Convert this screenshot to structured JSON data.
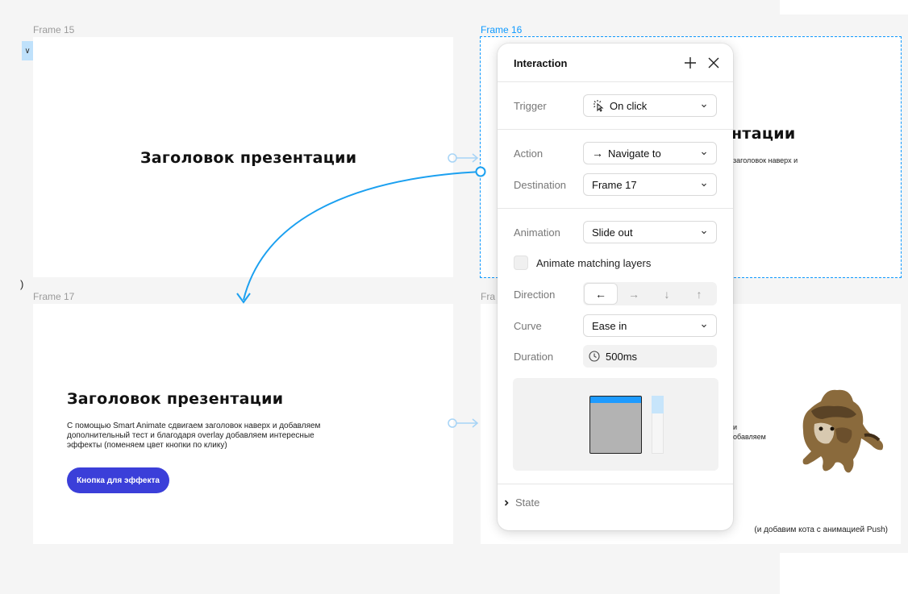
{
  "canvas": {
    "frames": [
      {
        "label": "Frame 15",
        "title": "Заголовок презентации"
      },
      {
        "label": "Frame 16",
        "title_partial": "нтации",
        "text_partial": "заголовок наверх и"
      },
      {
        "label": "Frame 17",
        "title": "Заголовок презентации",
        "text": "С помощью Smart Animate сдвигаем заголовок наверх и добавляем дополнительный тест и благодаря overlay добавляем интересные эффекты (поменяем цвет кнопки по клику)",
        "button_label": "Кнопка для эффекта"
      },
      {
        "label": "Fra",
        "text_partial_1": "и",
        "text_partial_2": "обавляем",
        "caption": "(и добавим кота с анимацией Push)"
      }
    ],
    "left_chip": "∨",
    "left_marker": ")"
  },
  "interaction_panel": {
    "title": "Interaction",
    "trigger": {
      "label": "Trigger",
      "value": "On click",
      "icon": "tap-icon"
    },
    "action": {
      "label": "Action",
      "value": "Navigate to",
      "icon": "→"
    },
    "destination": {
      "label": "Destination",
      "value": "Frame 17"
    },
    "animation": {
      "label": "Animation",
      "value": "Slide out"
    },
    "animate_matching": {
      "label": "Animate matching layers",
      "checked": false
    },
    "direction": {
      "label": "Direction",
      "options": [
        "←",
        "→",
        "↓",
        "↑"
      ],
      "selected": "←"
    },
    "curve": {
      "label": "Curve",
      "value": "Ease in"
    },
    "duration": {
      "label": "Duration",
      "value": "500ms"
    },
    "state": {
      "label": "State"
    }
  },
  "colors": {
    "accent": "#0d99ff",
    "button": "#3b3fd9",
    "preview_bar": "#1e9bff"
  }
}
